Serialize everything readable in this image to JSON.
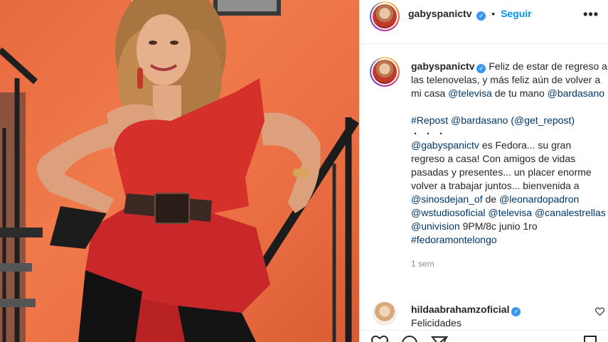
{
  "post": {
    "username": "gabyspanictv",
    "verified_glyph": "✓",
    "separator": "•",
    "follow_label": "Seguir",
    "more_label": "•••"
  },
  "caption": {
    "username": "gabyspanictv",
    "line1": "Feliz de estar de regreso a las telenovelas, y más feliz aún de volver a mi casa ",
    "mention_televisa": "@televisa",
    "line1b": " de tu mano ",
    "mention_bardasano": "@bardasano",
    "repost_tag": "#Repost",
    "repost_mention": "@bardasano",
    "repost_get": "(@get_repost)",
    "dots": "・・・",
    "mention_self": "@gabyspanictv",
    "body1": " es Fedora... su gran regreso a casa! Con amigos de vidas pasadas y presentes... un placer enorme volver a trabajar juntos... bienvenida a ",
    "mention_sinos": "@sinosdejan_of",
    "body2": " de ",
    "mention_leonardo": "@leonardopadron",
    "mention_wstudios": "@wstudiosoficial",
    "mention_televisa2": "@televisa",
    "mention_canal": "@canalestrellas",
    "mention_univision": "@univision",
    "body3": "9PM/8c junio 1ro ",
    "hashtag_fedora": "#fedoramontelongo",
    "time_ago": "1 sem"
  },
  "comment": {
    "username": "hildaabrahamzoficial",
    "text": "Felicidades",
    "like_icon": "heart-icon"
  },
  "colors": {
    "link": "#00376b",
    "follow": "#0095f6",
    "verified": "#3897f0",
    "background_wall": "#ea6d42"
  }
}
